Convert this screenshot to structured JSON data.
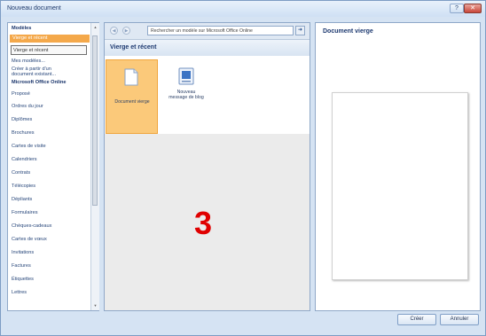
{
  "window": {
    "title": "Nouveau document",
    "help_icon": "help-icon",
    "close_icon": "close-icon"
  },
  "sidebar": {
    "items": [
      {
        "label": "Modèles",
        "kind": "header"
      },
      {
        "label": "Vierge et récent",
        "kind": "selected"
      },
      {
        "label": "Vierge et récent",
        "kind": "tooltip"
      },
      {
        "label": "Mes modèles...",
        "kind": "item"
      },
      {
        "label": "Créer à partir d'un",
        "kind": "item"
      },
      {
        "label": "document existant...",
        "kind": "item"
      },
      {
        "label": "Microsoft Office Online",
        "kind": "header"
      },
      {
        "label": "Proposé",
        "kind": "item"
      },
      {
        "label": "Ordres du jour",
        "kind": "item"
      },
      {
        "label": "Diplômes",
        "kind": "item"
      },
      {
        "label": "Brochures",
        "kind": "item"
      },
      {
        "label": "Cartes de visite",
        "kind": "item"
      },
      {
        "label": "Calendriers",
        "kind": "item"
      },
      {
        "label": "Contrats",
        "kind": "item"
      },
      {
        "label": "Télécopies",
        "kind": "item"
      },
      {
        "label": "Dépliants",
        "kind": "item"
      },
      {
        "label": "Formulaires",
        "kind": "item"
      },
      {
        "label": "Chèques-cadeaux",
        "kind": "item"
      },
      {
        "label": "Cartes de vœux",
        "kind": "item"
      },
      {
        "label": "Invitations",
        "kind": "item"
      },
      {
        "label": "Factures",
        "kind": "item"
      },
      {
        "label": "Étiquettes",
        "kind": "item"
      },
      {
        "label": "Lettres",
        "kind": "item"
      }
    ]
  },
  "middle": {
    "search_placeholder": "Rechercher un modèle sur Microsoft Office Online",
    "section_title": "Vierge et récent",
    "tiles": [
      {
        "label": "Document vierge",
        "icon": "blank-document-icon",
        "selected": true
      },
      {
        "label_line1": "Nouveau",
        "label_line2": "message de blog",
        "icon": "blog-post-icon",
        "selected": false
      }
    ],
    "overlay_number": "3"
  },
  "right": {
    "title": "Document vierge"
  },
  "buttons": {
    "ok": "Créer",
    "cancel": "Annuler"
  },
  "colors": {
    "selection": "#f4a84a",
    "overlay": "#e00000",
    "accent": "#1d3970"
  }
}
